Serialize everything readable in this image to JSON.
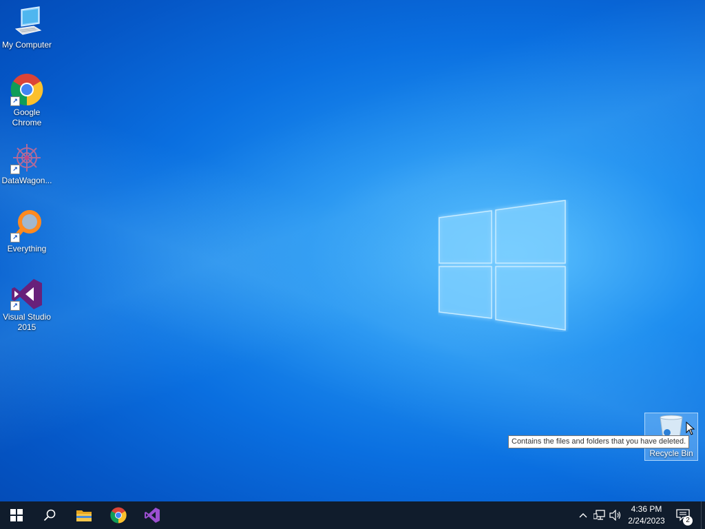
{
  "desktop": {
    "icons": [
      {
        "label": "My Computer",
        "icon": "computer-icon"
      },
      {
        "label": "Google Chrome",
        "icon": "chrome-icon"
      },
      {
        "label": "DataWagon...",
        "icon": "datawagon-icon"
      },
      {
        "label": "Everything",
        "icon": "everything-icon"
      },
      {
        "label": "Visual Studio 2015",
        "icon": "visual-studio-icon"
      }
    ],
    "recycle_bin": {
      "label": "Recycle Bin",
      "icon": "recycle-bin-icon"
    },
    "tooltip": "Contains the files and folders that you have deleted."
  },
  "taskbar": {
    "pinned": [
      {
        "name": "start",
        "icon": "windows-start-icon"
      },
      {
        "name": "search",
        "icon": "search-icon"
      },
      {
        "name": "file-explorer",
        "icon": "folder-icon"
      },
      {
        "name": "chrome",
        "icon": "chrome-icon"
      },
      {
        "name": "visual-studio",
        "icon": "visual-studio-icon"
      }
    ],
    "tray": {
      "time": "4:36 PM",
      "date": "2/24/2023",
      "notification_count": "2"
    }
  },
  "colors": {
    "taskbar": "#101c2c",
    "desktop_accent": "#0a6fe0",
    "vs_purple": "#68217a"
  }
}
